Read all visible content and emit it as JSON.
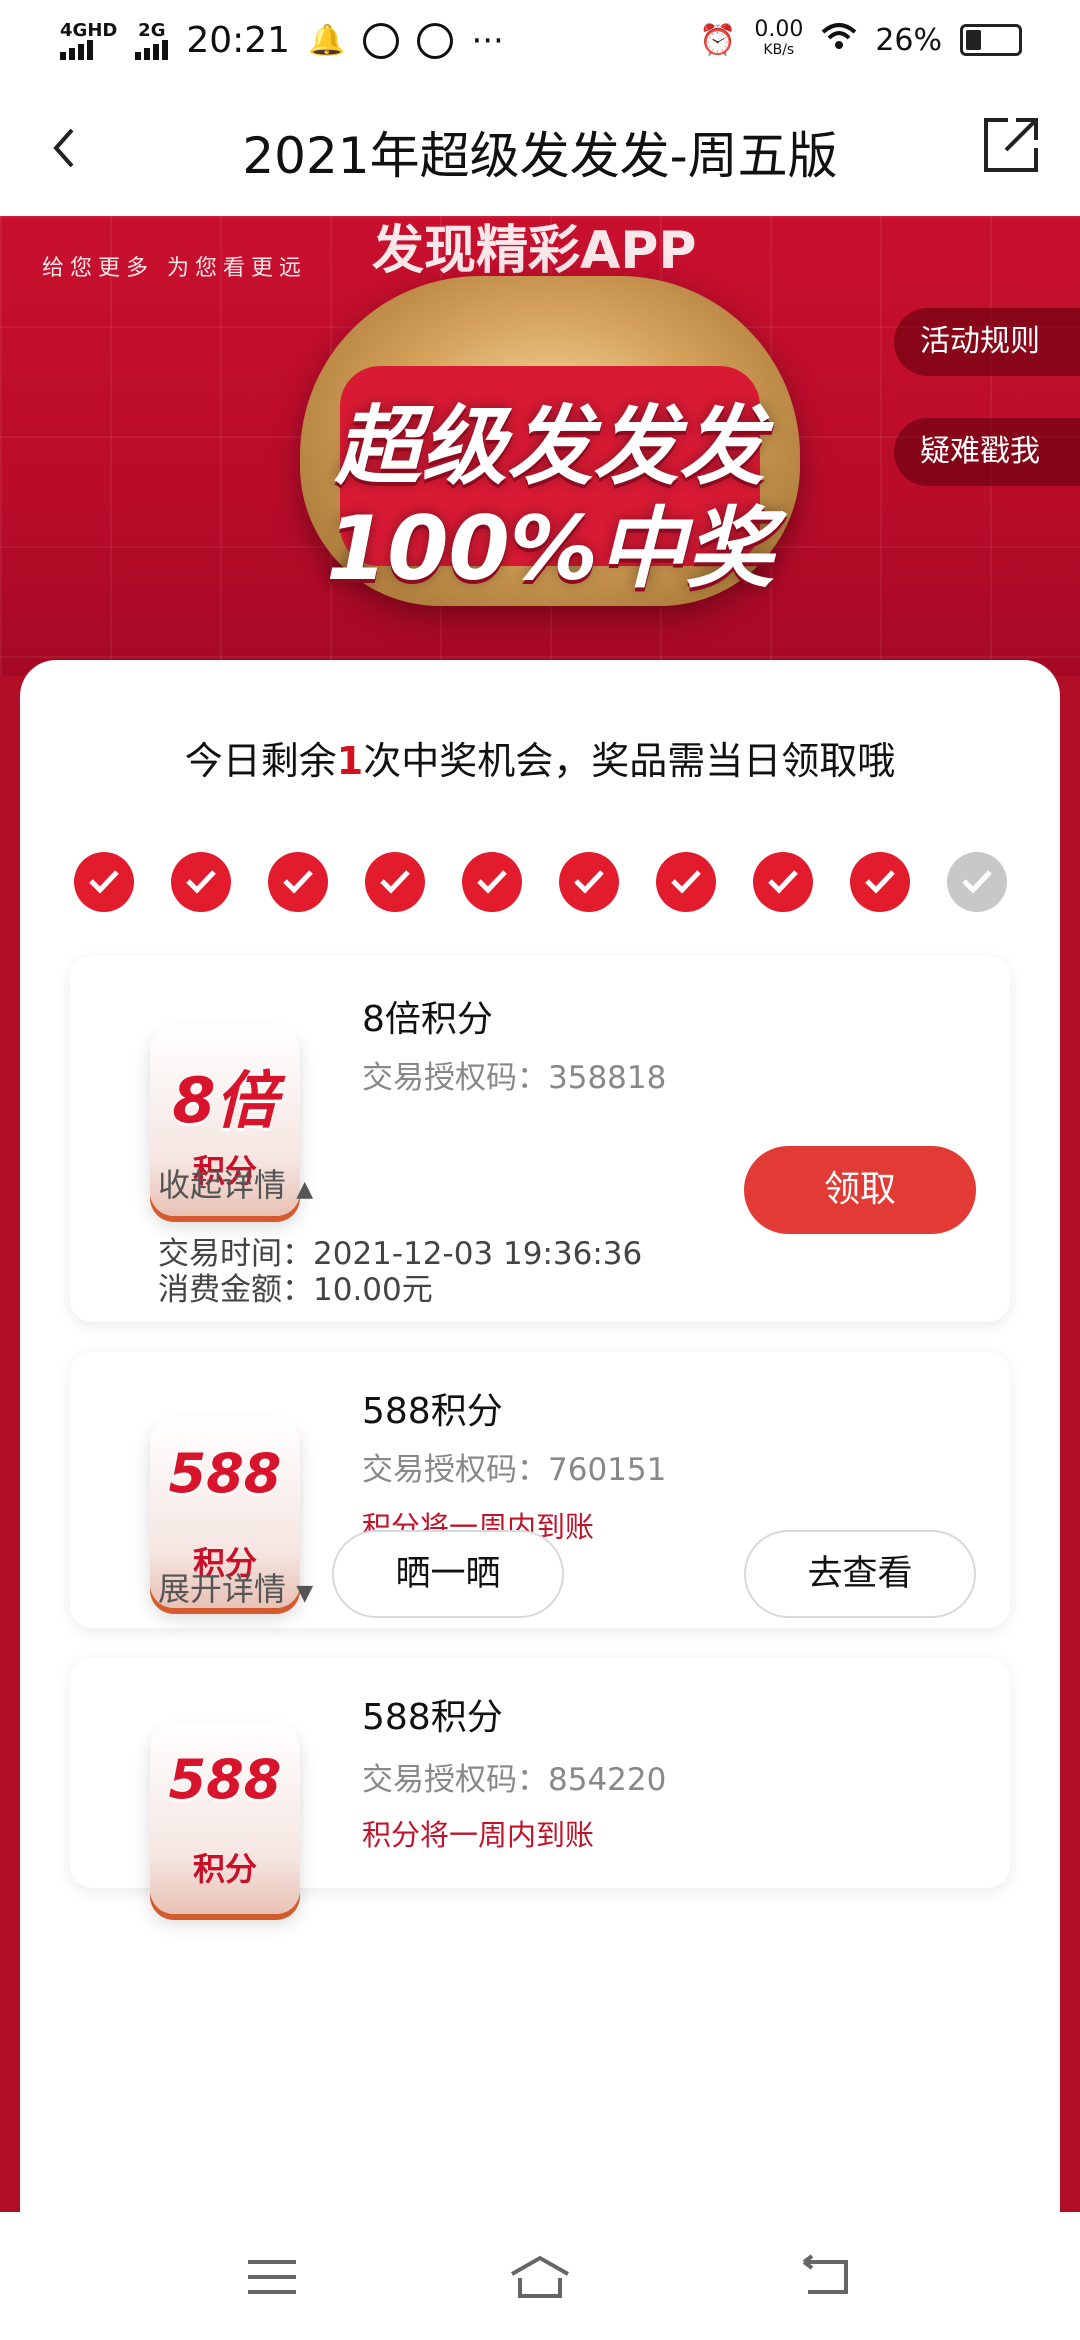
{
  "status": {
    "net1": "4G",
    "net1_sup": "HD",
    "net2": "2G",
    "time": "20:21",
    "more": "···",
    "speed_value": "0.00",
    "speed_unit": "KB/s",
    "battery": "26%",
    "battery_level": 0.26
  },
  "header": {
    "title": "2021年超级发发发-周五版"
  },
  "banner": {
    "brand_slogan": "给您更多 为您看更远",
    "app_name": "发现精彩APP",
    "headline_1": "超级发发发",
    "headline_2": "100%中奖",
    "rules_label": "活动规则",
    "help_label": "疑难戳我"
  },
  "main": {
    "info_prefix": "今日剩余",
    "info_count": "1",
    "info_suffix": "次中奖机会，奖品需当日领取哦",
    "checks": [
      true,
      true,
      true,
      true,
      true,
      true,
      true,
      true,
      true,
      false
    ]
  },
  "prizes": [
    {
      "tile_big": "8倍",
      "tile_small": "积分",
      "title": "8倍积分",
      "code_label": "交易授权码：",
      "code": "358818",
      "toggle": "收起详情",
      "claim_label": "领取",
      "time_label": "交易时间：",
      "time": "2021-12-03 19:36:36",
      "amount_label": "消费金额：",
      "amount": "10.00元"
    },
    {
      "tile_big": "588",
      "tile_small": "积分",
      "title": "588积分",
      "code_label": "交易授权码：",
      "code": "760151",
      "note": "积分将一周内到账",
      "toggle": "展开详情",
      "share_label": "晒一晒",
      "view_label": "去查看"
    },
    {
      "tile_big": "588",
      "tile_small": "积分",
      "title": "588积分",
      "code_label": "交易授权码：",
      "code": "854220",
      "note": "积分将一周内到账"
    }
  ]
}
